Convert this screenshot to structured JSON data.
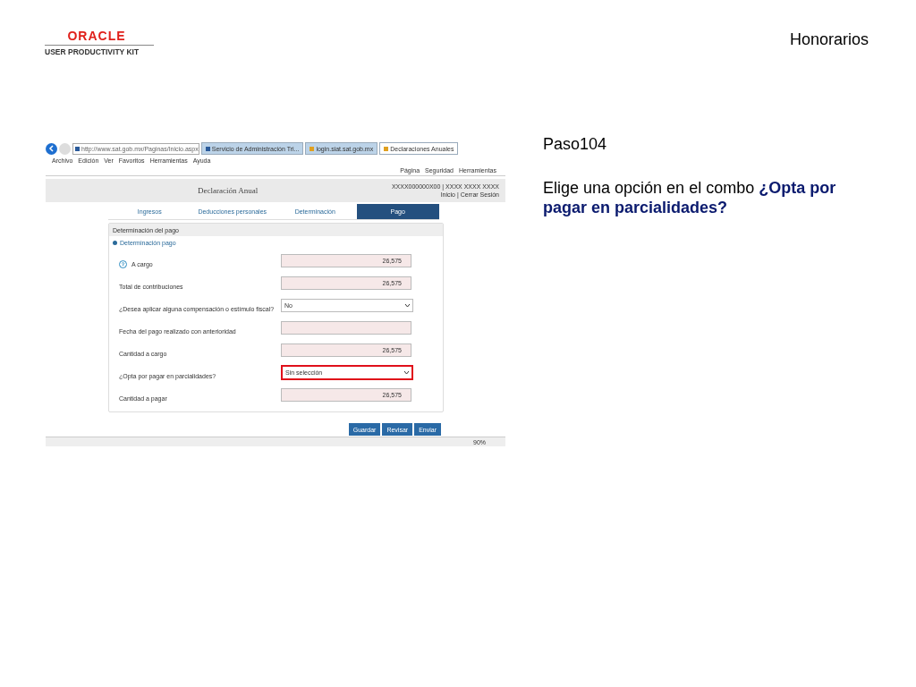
{
  "header": {
    "logo": {
      "brand": "ORACLE",
      "product": "USER PRODUCTIVITY KIT"
    },
    "title": "Honorarios"
  },
  "browser": {
    "address": "http://www.sat.gob.mx/Paginas/Inicio.aspx",
    "tabs": [
      {
        "label": "Servicio de Administración Tri...",
        "selected": false
      },
      {
        "label": "login.siat.sat.gob.mx",
        "selected": false
      },
      {
        "label": "Declaraciones Anuales",
        "selected": true
      }
    ],
    "menu": [
      "Archivo",
      "Edición",
      "Ver",
      "Favoritos",
      "Herramientas",
      "Ayuda"
    ],
    "toolbar": [
      "Página",
      "Seguridad",
      "Herramientas"
    ],
    "zoom": "90%"
  },
  "page": {
    "title": "Declaración Anual",
    "user": "XXXX000000X00 | XXXX XXXX XXXX",
    "links": [
      "Inicio",
      "Cerrar Sesión"
    ],
    "link_separator": "|",
    "tabs": [
      {
        "label": "Ingresos",
        "selected": false
      },
      {
        "label": "Deducciones personales",
        "selected": false
      },
      {
        "label": "Determinación",
        "selected": false
      },
      {
        "label": "Pago",
        "selected": true
      }
    ],
    "panel_title": "Determinación del pago",
    "section": "Determinación pago",
    "fields": [
      {
        "label": "A cargo",
        "kind": "readonly",
        "value": "26,575",
        "help": true,
        "highlighted": false
      },
      {
        "label": "Total de contribuciones",
        "kind": "readonly",
        "value": "26,575",
        "help": false,
        "highlighted": false
      },
      {
        "label": "¿Desea aplicar alguna compensación o estímulo fiscal?",
        "kind": "select",
        "value": "No",
        "help": false,
        "highlighted": false
      },
      {
        "label": "Fecha del pago realizado con anterioridad",
        "kind": "readonly",
        "help": false,
        "highlighted": false
      },
      {
        "label": "Cantidad a cargo",
        "kind": "readonly",
        "value": "26,575",
        "help": false,
        "highlighted": false
      },
      {
        "label": "¿Opta por pagar en parcialidades?",
        "kind": "select",
        "value": "Sin selección",
        "help": false,
        "highlighted": true
      },
      {
        "label": "Cantidad a pagar",
        "kind": "readonly",
        "value": "26,575",
        "help": false,
        "highlighted": false
      }
    ],
    "buttons": [
      "Guardar",
      "Revisar",
      "Enviar"
    ]
  },
  "step": "Paso104",
  "instruction": "Elige una opción en el combo **¿Opta por pagar en parcialidades?**"
}
